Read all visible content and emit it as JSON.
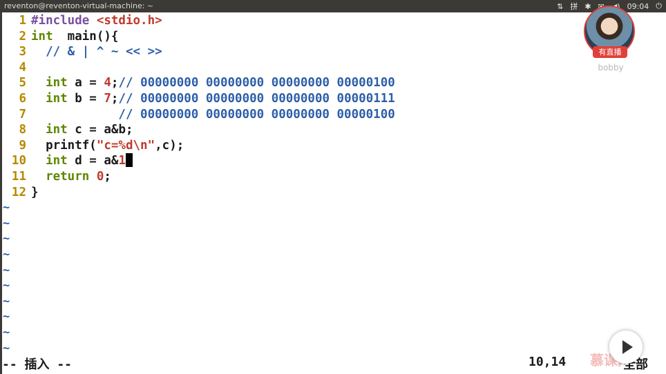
{
  "window_title": "reventon@reventon-virtual-machine: ~",
  "tray": {
    "sort_glyph": "⇅",
    "input_method": "拼",
    "bluetooth_glyph": "✱",
    "mail_glyph": "✉",
    "volume_glyph": "◀)",
    "clock": "09:04",
    "power_glyph": "⏻"
  },
  "editor": {
    "lines": [
      {
        "n": "1",
        "parts": [
          [
            "pp",
            "#include "
          ],
          [
            "inc",
            "<stdio.h>"
          ]
        ]
      },
      {
        "n": "2",
        "parts": [
          [
            "kw",
            "int"
          ],
          [
            "",
            "  main(){"
          ]
        ]
      },
      {
        "n": "3",
        "parts": [
          [
            "cmt",
            "  // & | ^ ~ << >>"
          ]
        ]
      },
      {
        "n": "4",
        "parts": []
      },
      {
        "n": "5",
        "parts": [
          [
            "",
            "  "
          ],
          [
            "kw",
            "int"
          ],
          [
            "",
            " a = "
          ],
          [
            "num",
            "4"
          ],
          [
            "",
            ";"
          ],
          [
            "cmt",
            "// 00000000 00000000 00000000 00000100"
          ]
        ]
      },
      {
        "n": "6",
        "parts": [
          [
            "",
            "  "
          ],
          [
            "kw",
            "int"
          ],
          [
            "",
            " b = "
          ],
          [
            "num",
            "7"
          ],
          [
            "",
            ";"
          ],
          [
            "cmt",
            "// 00000000 00000000 00000000 00000111"
          ]
        ]
      },
      {
        "n": "7",
        "parts": [
          [
            "cmt",
            "            // 00000000 00000000 00000000 00000100"
          ]
        ]
      },
      {
        "n": "8",
        "parts": [
          [
            "",
            "  "
          ],
          [
            "kw",
            "int"
          ],
          [
            "",
            " c = a&b;"
          ]
        ]
      },
      {
        "n": "9",
        "parts": [
          [
            "",
            "  printf("
          ],
          [
            "str",
            "\"c=%d\\n\""
          ],
          [
            "",
            ",c);"
          ]
        ]
      },
      {
        "n": "10",
        "parts": [
          [
            "",
            "  "
          ],
          [
            "kw",
            "int"
          ],
          [
            "",
            " d = a&"
          ],
          [
            "num",
            "1"
          ]
        ],
        "cursor": true
      },
      {
        "n": "11",
        "parts": [
          [
            "",
            "  "
          ],
          [
            "kw",
            "return"
          ],
          [
            "",
            " "
          ],
          [
            "num",
            "0"
          ],
          [
            "",
            ";"
          ]
        ]
      },
      {
        "n": "12",
        "parts": [
          [
            "",
            "}"
          ]
        ]
      }
    ],
    "tilde": "~",
    "tilde_count": 10
  },
  "status": {
    "mode": "-- 插入 --",
    "position": "10,14",
    "scroll": "全部"
  },
  "overlay": {
    "live_badge": "有直播",
    "streamer": "bobby",
    "watermark": "慕课网"
  },
  "colors": {
    "line_number": "#b58900",
    "keyword": "#5f8700",
    "comment": "#2c5ea8",
    "string": "#c0392b",
    "accent": "#e0403a"
  }
}
